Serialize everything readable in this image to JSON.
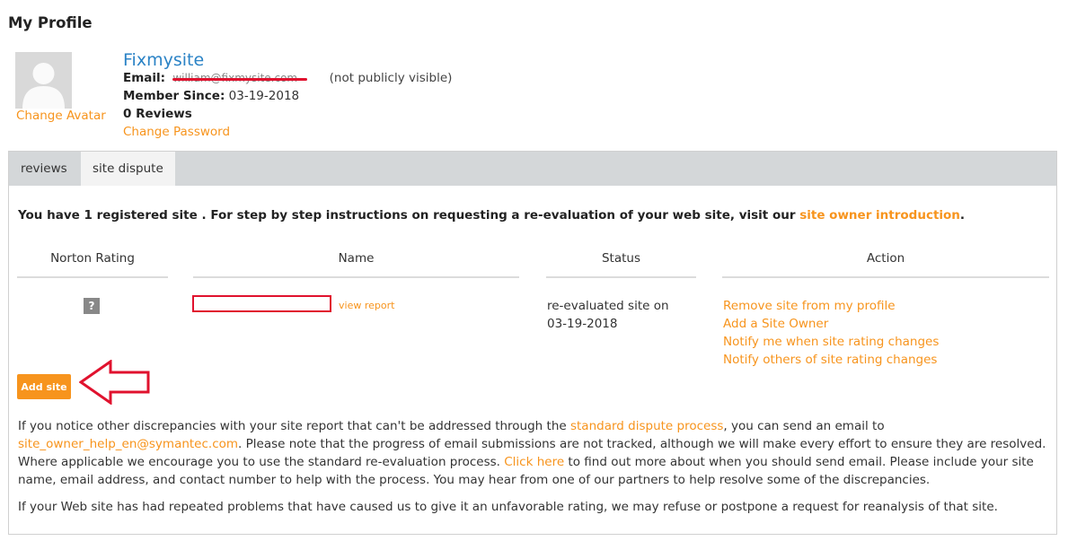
{
  "page": {
    "title": "My Profile"
  },
  "profile": {
    "change_avatar": "Change Avatar",
    "name": "Fixmysite",
    "email_label": "Email",
    "email_value": "william@fixmysite.com",
    "email_note": "(not publicly visible)",
    "member_since_label": "Member Since",
    "member_since_value": "03-19-2018",
    "reviews": "0 Reviews",
    "change_password": "Change Password"
  },
  "tabs": [
    {
      "label": "reviews",
      "active": false
    },
    {
      "label": "site dispute",
      "active": true
    }
  ],
  "intro": {
    "text": "You have 1 registered site . For step by step instructions on requesting a re-evaluation of your web site, visit our ",
    "link": "site owner introduction",
    "end": "."
  },
  "table": {
    "headers": [
      "Norton Rating",
      "Name",
      "Status",
      "Action"
    ],
    "row": {
      "rating_icon": "?",
      "name_redacted": true,
      "view_report": "view report",
      "status_line1": "re-evaluated site on",
      "status_line2": "03-19-2018",
      "actions": [
        "Remove site from my profile",
        "Add a Site Owner",
        "Notify me when site rating changes",
        "Notify others of site rating changes"
      ]
    }
  },
  "add_site_label": "Add site",
  "footer": {
    "p1_a": "If you notice other discrepancies with your site report that can't be addressed through the ",
    "p1_link1": "standard dispute process",
    "p1_b": ", you can send an email to ",
    "p1_email": "site_owner_help_en@symantec.com",
    "p1_c": ". Please note that the progress of email submissions are not tracked, although we will make every effort to ensure they are resolved. Where applicable we encourage you to use the standard re-evaluation process. ",
    "p1_link2": "Click here",
    "p1_d": " to find out more about when you should send email. Please include your site name, email address, and contact number to help with the process. You may hear from one of our partners to help resolve some of the discrepancies.",
    "p2": "If your Web site has had repeated problems that have caused us to give it an unfavorable rating, we may refuse or postpone a request for reanalysis of that site."
  },
  "colors": {
    "accent": "#f7941d",
    "link_blue": "#2b83c6",
    "annotation_red": "#e0122e"
  }
}
